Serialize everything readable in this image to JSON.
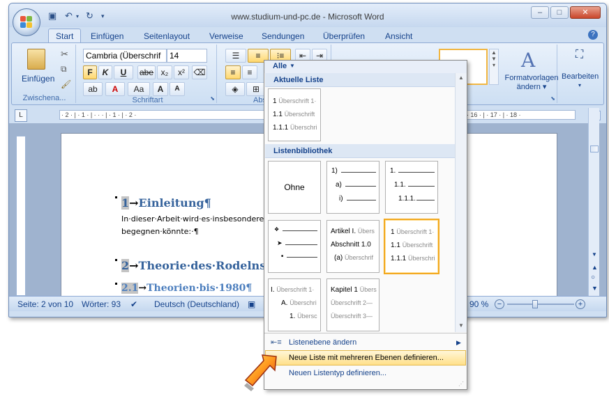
{
  "window": {
    "title": "www.studium-und-pc.de - Microsoft Word",
    "minimize": "–",
    "maximize": "□",
    "close": "✕"
  },
  "tabs": [
    "Start",
    "Einfügen",
    "Seitenlayout",
    "Verweise",
    "Sendungen",
    "Überprüfen",
    "Ansicht"
  ],
  "ribbon": {
    "clipboard": {
      "paste_label": "Einfügen",
      "group_label": "Zwischena..."
    },
    "font": {
      "font_name": "Cambria (Überschrif",
      "font_size": "14",
      "group_label": "Schriftart",
      "bold": "F",
      "italic": "K",
      "underline": "U",
      "strike": "abe",
      "subscript": "x₂",
      "superscript": "x²",
      "change_case": "Aa",
      "grow": "A",
      "shrink": "A"
    },
    "paragraph": {
      "group_label": "Absa"
    },
    "styles": {
      "change_label_1": "Formatvorlagen",
      "change_label_2": "ändern"
    },
    "editing": {
      "label": "Bearbeiten"
    }
  },
  "ruler": {
    "marks": "· 2 · | · 1 · | · · · | · 1 · | · 2 ·",
    "right_marks": "15 · | · 16 · | · 17 · | · 18 ·"
  },
  "document": {
    "h1_number": "1",
    "h1_text": "Einleitung¶",
    "p1_line1": "In·dieser·Arbeit·wird·es·insbesondere·d",
    "p1_line2": "begegnen·könnte:·¶",
    "h2_number": "2",
    "h2_text": "Theorie·des·Rodelns¶",
    "h3_number": "2.1",
    "h3_text": "Theorien·bis·1980¶"
  },
  "statusbar": {
    "page": "Seite: 2 von 10",
    "words": "Wörter: 93",
    "language": "Deutsch (Deutschland)",
    "zoom": "90 %"
  },
  "gallery": {
    "filter": "Alle",
    "section_current": "Aktuelle Liste",
    "section_library": "Listenbibliothek",
    "none_label": "Ohne",
    "current_list": [
      {
        "num": "1",
        "text": "Überschrift 1·"
      },
      {
        "num": "1.1",
        "text": "Überschrift"
      },
      {
        "num": "1.1.1",
        "text": "Überschri"
      }
    ],
    "lib_numbered_a": [
      "1)",
      "a)",
      "i)"
    ],
    "lib_numbered_b": [
      "1.",
      "1.1.",
      "1.1.1."
    ],
    "lib_bullets": [
      "❖",
      "➤",
      "■"
    ],
    "lib_article": [
      {
        "num": "Artikel I.",
        "text": "Übers"
      },
      {
        "num": "Abschnitt 1.0",
        "text": ""
      },
      {
        "num": "(a)",
        "text": "Überschrif"
      }
    ],
    "lib_selected": [
      {
        "num": "1",
        "text": "Überschrift 1·"
      },
      {
        "num": "1.1",
        "text": "Überschrift"
      },
      {
        "num": "1.1.1",
        "text": "Überschri"
      }
    ],
    "lib_roman": [
      {
        "num": "I.",
        "text": "Überschrift 1·"
      },
      {
        "num": "A.",
        "text": "Überschri"
      },
      {
        "num": "1.",
        "text": "Übersc"
      }
    ],
    "lib_chapter": [
      {
        "num": "Kapitel 1",
        "text": "Übers"
      },
      {
        "num": "",
        "text": "Überschrift 2—"
      },
      {
        "num": "",
        "text": "Überschrift 3—"
      }
    ],
    "menu": {
      "change_level": "Listenebene ändern",
      "define_multilevel": "Neue Liste mit mehreren Ebenen definieren...",
      "define_style": "Neuen Listentyp definieren..."
    }
  }
}
